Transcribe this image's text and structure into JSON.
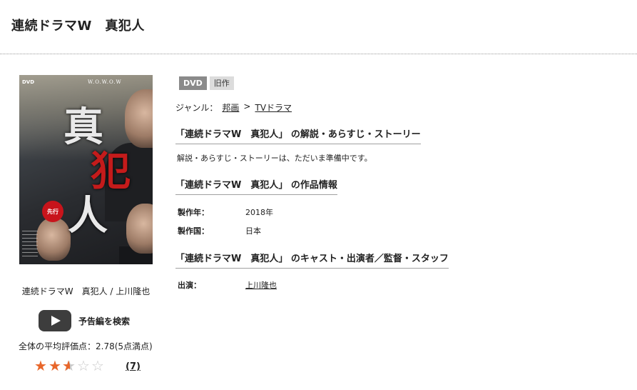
{
  "page": {
    "title": "連続ドラマW　真犯人"
  },
  "poster": {
    "caption": "連続ドラマW　真犯人 / 上川隆也",
    "logo_text": "W.O.W.O.W",
    "dvd_mark": "DVD",
    "title_chars": [
      "真",
      "犯",
      "人"
    ],
    "badge_text": "先行"
  },
  "trailer": {
    "label": "予告編を検索",
    "icon": "play-icon"
  },
  "rating": {
    "average_text": "全体の平均評価点：2.78(5点満点)",
    "value": 2.78,
    "max": 5,
    "review_count": "(7)"
  },
  "tags": {
    "format": "DVD",
    "age": "旧作"
  },
  "genre": {
    "label": "ジャンル：",
    "parent": "邦画",
    "separator": ">",
    "child": "TVドラマ"
  },
  "sections": {
    "synopsis_title": "「連続ドラマW　真犯人」 の解説・あらすじ・ストーリー",
    "synopsis_text": "解説・あらすじ・ストーリーは、ただいま準備中です。",
    "info_title": "「連続ドラマW　真犯人」 の作品情報",
    "cast_title": "「連続ドラマW　真犯人」 のキャスト・出演者／監督・スタッフ"
  },
  "info": {
    "year_label": "製作年：",
    "year_value": "2018年",
    "country_label": "製作国：",
    "country_value": "日本"
  },
  "cast": {
    "label": "出演：",
    "value": "上川隆也"
  },
  "colors": {
    "star": "#e8662a",
    "tag_dvd": "#8a8a8a",
    "tag_old": "#dcdcdc"
  }
}
